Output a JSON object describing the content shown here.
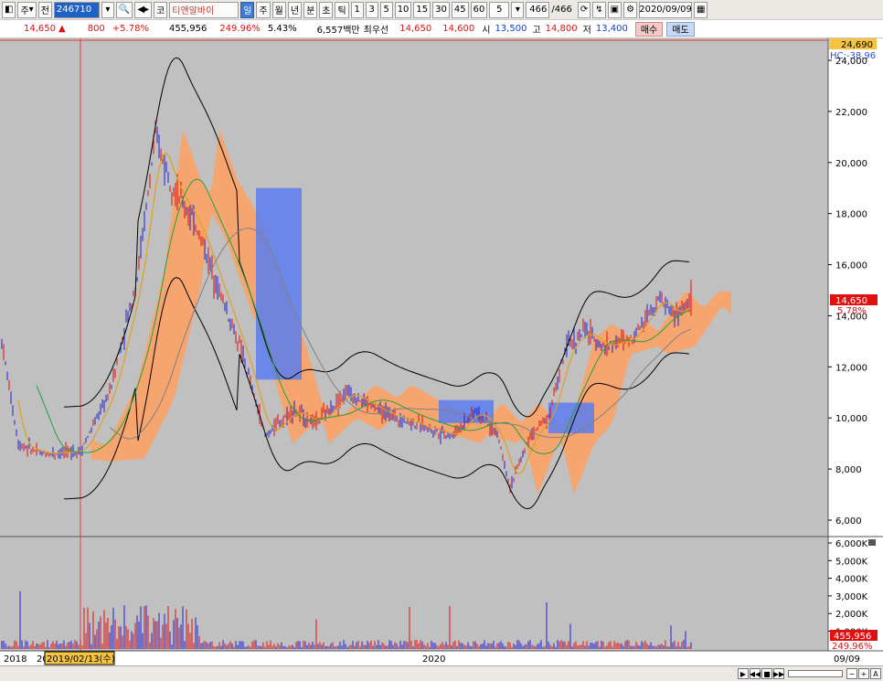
{
  "toolbar": {
    "period_label": "주",
    "market_label": "전",
    "stock_code": "246710",
    "market_badge": "코",
    "stock_name": "티앤알바이",
    "periods": [
      "일",
      "주",
      "월",
      "년",
      "분",
      "초",
      "틱"
    ],
    "intervals": [
      "1",
      "3",
      "5",
      "10",
      "15",
      "30",
      "45",
      "60"
    ],
    "interval_value": "5",
    "count_current": "466",
    "count_total": "/466",
    "date": "2020/09/09"
  },
  "quote": {
    "price": "14,650",
    "change": "800",
    "change_pct": "+5.78%",
    "volume": "455,956",
    "volume_ratio": "249.96%",
    "turnover": "5.43%",
    "amount": "6,557백만",
    "best_label": "최우선",
    "best_ask": "14,650",
    "best_bid": "14,600",
    "open_label": "시",
    "open": "13,500",
    "high_label": "고",
    "high": "14,800",
    "low_label": "저",
    "low": "13,400",
    "buy_label": "매수",
    "sell_label": "매도"
  },
  "price_axis": {
    "max_label": "24,690",
    "hc_label": "HC:-38.96",
    "ticks": [
      "24,000",
      "22,000",
      "20,000",
      "18,000",
      "16,000",
      "14,000",
      "12,000",
      "10,000",
      "8,000",
      "6,000"
    ],
    "current_label": "14,650",
    "current_pct": "5.78%"
  },
  "volume_axis": {
    "ticks": [
      "6,000K",
      "5,000K",
      "4,000K",
      "3,000K",
      "2,000K",
      "1,000K"
    ],
    "current_label": "455,956",
    "current_pct": "249.96%"
  },
  "time_axis": {
    "labels": [
      "2018",
      "20",
      "2020"
    ],
    "cursor_date": "2019/02/13(수)",
    "last_date": "09/09"
  },
  "colors": {
    "chart_bg": "#c0c0c0",
    "up": "#e01010",
    "down": "#2020d0",
    "cloud_up": "#ffa060",
    "cloud_down": "#5a7cf0",
    "bollinger": "#000000",
    "ma_short": "#e0a020",
    "ma_mid": "#20a040",
    "ma_long": "#808080"
  }
}
